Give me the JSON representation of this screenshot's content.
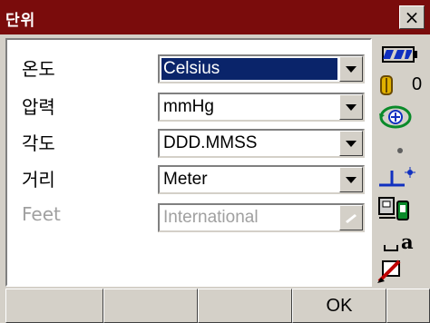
{
  "window": {
    "title": "단위",
    "close_label": "×"
  },
  "fields": [
    {
      "label": "온도",
      "value": "Celsius",
      "enabled": true,
      "selected": true
    },
    {
      "label": "압력",
      "value": "mmHg",
      "enabled": true,
      "selected": false
    },
    {
      "label": "각도",
      "value": "DDD.MMSS",
      "enabled": true,
      "selected": false
    },
    {
      "label": "거리",
      "value": "Meter",
      "enabled": true,
      "selected": false
    },
    {
      "label": "Feet",
      "value": "International",
      "enabled": false,
      "selected": false
    }
  ],
  "status": {
    "battery_icon": "battery-icon",
    "prism_constant": "0",
    "compensator_icon": "compensator-icon",
    "laser_icon": "laser-dot-icon",
    "plumb_icon": "laser-plummet-icon",
    "comm_icon": "communication-icon",
    "input_mode": "a",
    "edit_icon": "edit-pencil-icon"
  },
  "softkeys": [
    "",
    "",
    "",
    "OK",
    ""
  ],
  "colors": {
    "titlebar": "#7a0c0c",
    "selection": "#0a246a",
    "accent_green": "#0a8a2a",
    "accent_blue": "#1030c0"
  }
}
